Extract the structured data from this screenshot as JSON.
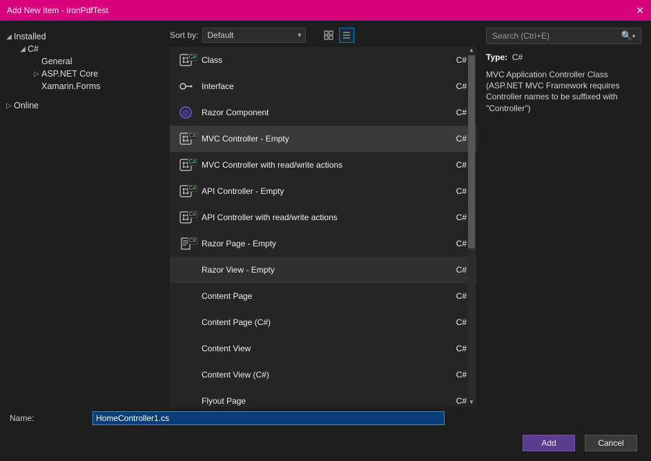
{
  "titlebar": {
    "title": "Add New Item - IronPdfTest"
  },
  "tree": {
    "installed": "Installed",
    "csharp": "C#",
    "general": "General",
    "aspnet": "ASP.NET Core",
    "xamarin": "Xamarin.Forms",
    "online": "Online"
  },
  "sortbar": {
    "label": "Sort by:",
    "value": "Default"
  },
  "items": [
    {
      "label": "Class",
      "lang": "C#",
      "icon": "class",
      "badge": true
    },
    {
      "label": "Interface",
      "lang": "C#",
      "icon": "interface"
    },
    {
      "label": "Razor Component",
      "lang": "C#",
      "icon": "razor"
    },
    {
      "label": "MVC Controller - Empty",
      "lang": "C#",
      "icon": "class",
      "badge": true,
      "selected": true
    },
    {
      "label": "MVC Controller with read/write actions",
      "lang": "C#",
      "icon": "class",
      "badge": true
    },
    {
      "label": "API Controller - Empty",
      "lang": "C#",
      "icon": "class",
      "badge": true
    },
    {
      "label": "API Controller with read/write actions",
      "lang": "C#",
      "icon": "class",
      "badge": true
    },
    {
      "label": "Razor Page - Empty",
      "lang": "C#",
      "icon": "page",
      "badge": true
    },
    {
      "label": "Razor View - Empty",
      "lang": "C#",
      "icon": "",
      "hover": true
    },
    {
      "label": "Content Page",
      "lang": "C#",
      "icon": ""
    },
    {
      "label": "Content Page (C#)",
      "lang": "C#",
      "icon": ""
    },
    {
      "label": "Content View",
      "lang": "C#",
      "icon": ""
    },
    {
      "label": "Content View (C#)",
      "lang": "C#",
      "icon": ""
    },
    {
      "label": "Flyout Page",
      "lang": "C#",
      "icon": ""
    }
  ],
  "search": {
    "placeholder": "Search (Ctrl+E)"
  },
  "detail": {
    "typeLabel": "Type:",
    "typeValue": "C#",
    "description": "MVC Application Controller Class (ASP.NET MVC Framework requires Controller names to be suffixed with \"Controller\")"
  },
  "footer": {
    "nameLabel": "Name:",
    "nameValue": "HomeController1.cs",
    "addLabel": "Add",
    "cancelLabel": "Cancel"
  }
}
